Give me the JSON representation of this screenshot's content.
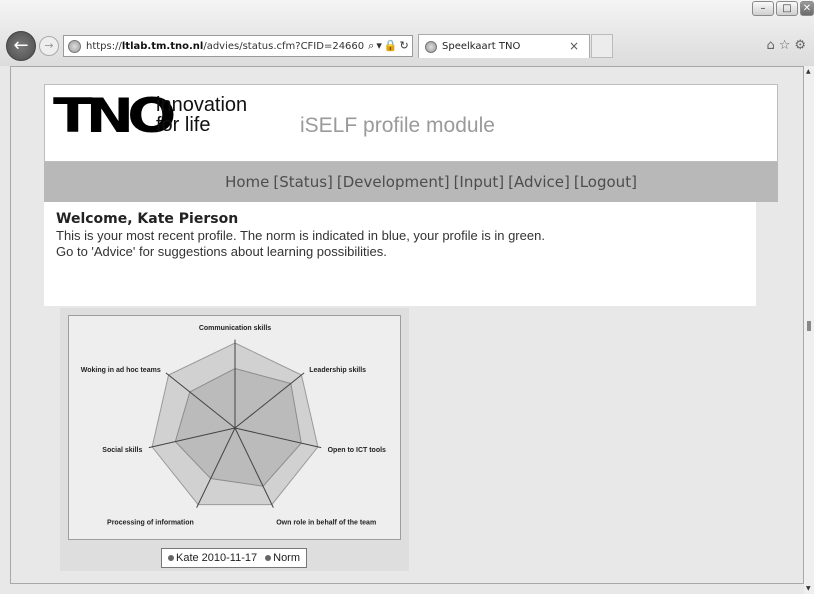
{
  "browser": {
    "url_prefix": "https://",
    "url_host": "ltlab.tm.tno.nl",
    "url_path": "/advies/status.cfm?CFID=24660",
    "tab_title": "Speelkaart TNO"
  },
  "header": {
    "logo_text": "TNO",
    "tagline_line1": "innovation",
    "tagline_line2": "for life",
    "module_title": "iSELF profile module"
  },
  "nav": {
    "home": "Home",
    "status": "[Status]",
    "development": "[Development]",
    "input": "[Input]",
    "advice": "[Advice]",
    "logout": "[Logout]"
  },
  "welcome": {
    "title": "Welcome, Kate Pierson",
    "line1": "This is your most recent profile. The norm is indicated in blue, your profile is in green.",
    "line2": "Go to 'Advice' for suggestions about learning possibilities."
  },
  "chart_data": {
    "type": "radar",
    "categories": [
      "Communication skills",
      "Leadership skills",
      "Open to ICT tools",
      "Own role in behalf of the team",
      "Processing of information",
      "Social skills",
      "Woking in ad hoc teams"
    ],
    "ylim": [
      0,
      5
    ],
    "series": [
      {
        "name": "Kate 2010-11-17",
        "values": [
          5,
          5,
          5,
          5,
          5,
          5,
          5
        ]
      },
      {
        "name": "Norm",
        "values": [
          3.5,
          4.2,
          4.0,
          3.8,
          3.3,
          3.6,
          3.4
        ]
      }
    ],
    "colors": [
      "#bdbdbd",
      "#cfcfcf"
    ]
  }
}
